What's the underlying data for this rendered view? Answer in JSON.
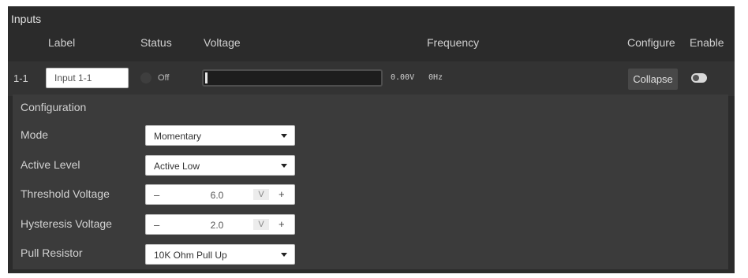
{
  "panel": {
    "title": "Inputs"
  },
  "columns": {
    "label": "Label",
    "status": "Status",
    "voltage": "Voltage",
    "frequency": "Frequency",
    "configure": "Configure",
    "enable": "Enable"
  },
  "input_row": {
    "id": "1-1",
    "label_value": "Input 1-1",
    "status": "Off",
    "voltage_level_fraction": 0.0,
    "voltage_readout": "0.00V",
    "frequency_readout": "0Hz",
    "collapse_label": "Collapse",
    "enabled": true
  },
  "configuration": {
    "title": "Configuration",
    "mode": {
      "label": "Mode",
      "value": "Momentary"
    },
    "active_level": {
      "label": "Active Level",
      "value": "Active Low"
    },
    "threshold_voltage": {
      "label": "Threshold Voltage",
      "value": "6.0",
      "unit": "V",
      "minus": "–",
      "plus": "+"
    },
    "hysteresis_voltage": {
      "label": "Hysteresis Voltage",
      "value": "2.0",
      "unit": "V",
      "minus": "–",
      "plus": "+"
    },
    "pull_resistor": {
      "label": "Pull Resistor",
      "value": "10K Ohm Pull Up"
    }
  },
  "colors": {
    "panel_bg": "#2b2b2b",
    "row_bg": "#333333",
    "config_bg": "#3b3b3b",
    "status_off": "#3e3e3e",
    "text": "#d8d8d8"
  },
  "icons": {
    "status": "status-indicator-dot",
    "dropdown": "chevron-down-icon",
    "enable": "toggle-switch"
  }
}
